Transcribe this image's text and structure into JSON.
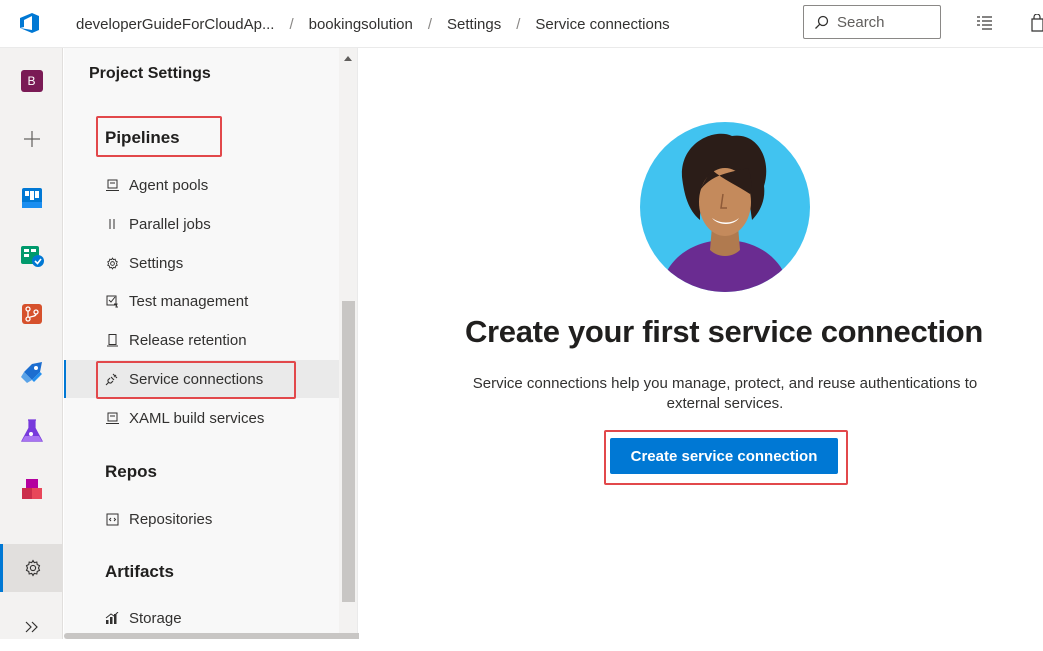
{
  "breadcrumb": [
    "developerGuideForCloudAp...",
    "bookingsolution",
    "Settings",
    "Service connections"
  ],
  "search": {
    "placeholder": "Search"
  },
  "rail": {
    "project_badge": "B",
    "items": [
      "project-avatar",
      "add-icon",
      "boards-icon",
      "test-plans-check-icon",
      "repos-icon",
      "pipelines-icon",
      "test-plans-icon",
      "artifacts-icon",
      "settings-icon",
      "expand-icon"
    ]
  },
  "nav": {
    "title": "Project Settings",
    "sections": [
      {
        "label": "Pipelines",
        "items": [
          {
            "label": "Agent pools",
            "icon": "agent-pool-icon"
          },
          {
            "label": "Parallel jobs",
            "icon": "parallel-jobs-icon"
          },
          {
            "label": "Settings",
            "icon": "settings-gear-icon"
          },
          {
            "label": "Test management",
            "icon": "test-management-icon"
          },
          {
            "label": "Release retention",
            "icon": "release-retention-icon"
          },
          {
            "label": "Service connections",
            "icon": "plug-icon",
            "selected": true
          },
          {
            "label": "XAML build services",
            "icon": "xaml-build-icon"
          }
        ]
      },
      {
        "label": "Repos",
        "items": [
          {
            "label": "Repositories",
            "icon": "repositories-icon"
          }
        ]
      },
      {
        "label": "Artifacts",
        "items": [
          {
            "label": "Storage",
            "icon": "storage-icon"
          }
        ]
      }
    ]
  },
  "main": {
    "headline": "Create your first service connection",
    "description": "Service connections help you manage, protect, and reuse authentications to external services.",
    "cta_label": "Create service connection"
  },
  "colors": {
    "accent": "#0078d4",
    "highlight": "#e2484b"
  }
}
